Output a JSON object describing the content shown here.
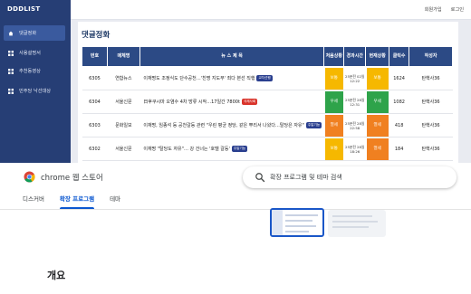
{
  "site": {
    "logo": "DDDLIST",
    "menu": [
      {
        "label": "댓글정화",
        "icon": "home-icon",
        "active": true
      },
      {
        "label": "사용설명서",
        "icon": "grid-icon",
        "active": false
      },
      {
        "label": "추천동영상",
        "icon": "grid-icon",
        "active": false
      },
      {
        "label": "민주당 낙선대상",
        "icon": "grid-icon",
        "active": false
      }
    ],
    "top_links": {
      "signup": "회원가입",
      "login": "로그인"
    },
    "content_title": "댓글정화",
    "table": {
      "headers": [
        "번호",
        "매체명",
        "뉴 스 제 목",
        "처음상황",
        "경과시간",
        "현재상황",
        "클릭수",
        "작성자"
      ],
      "rows": [
        {
          "no": "6305",
          "media": "연합뉴스",
          "title": "이재명도 조정식도 단수공천…'친명 지도부' 죄다 본선 직행",
          "tag": "교차선행",
          "tag_color": "#2a3f8f",
          "first": "보통",
          "first_color": "#f6b800",
          "elapsed": "25분전 02일 12:22",
          "current": "보통",
          "current_color": "#f6b800",
          "clicks": "1624",
          "writer": "탄핵사36"
        },
        {
          "no": "6304",
          "media": "서울신문",
          "title": "日후쿠시마 오염수 4차 방류 시작…17일간 7800t",
          "tag": "국제사회",
          "tag_color": "#d9342b",
          "first": "우세",
          "first_color": "#2ea34a",
          "elapsed": "25분전 28일 12:31",
          "current": "우세",
          "current_color": "#2ea34a",
          "clicks": "1082",
          "writer": "탄핵사36"
        },
        {
          "no": "6303",
          "media": "문화일보",
          "title": "이재명, 임종석 등 공천갈등 관련 \"우린 평균 정당, 같은 뿌리서 나왔다…탈당은 자유\"",
          "tag": "주말기능",
          "tag_color": "#2a3f8f",
          "first": "열세",
          "first_color": "#f08020",
          "elapsed": "25분전 28일 22:58",
          "current": "열세",
          "current_color": "#f08020",
          "clicks": "418",
          "writer": "탄핵사36"
        },
        {
          "no": "6302",
          "media": "서울신문",
          "title": "이재명 \"탈당도 자유\"… 강 건너는 '호텔 갈등'",
          "tag": "주말기능",
          "tag_color": "#2a3f8f",
          "first": "보통",
          "first_color": "#f6b800",
          "elapsed": "25분전 28일 18:26",
          "current": "열세",
          "current_color": "#f08020",
          "clicks": "184",
          "writer": "탄핵사36"
        }
      ]
    }
  },
  "store": {
    "name": "chrome 웹 스토어",
    "search_placeholder": "확장 프로그램 및 테마 검색",
    "tabs": [
      {
        "label": "디스커버",
        "active": false
      },
      {
        "label": "확장 프로그램",
        "active": true
      },
      {
        "label": "테마",
        "active": false
      }
    ],
    "overview_heading": "개요"
  },
  "colors": {
    "sidebar": "#263e75",
    "table_header": "#2c4a85",
    "accent_blue": "#0b57d0"
  }
}
